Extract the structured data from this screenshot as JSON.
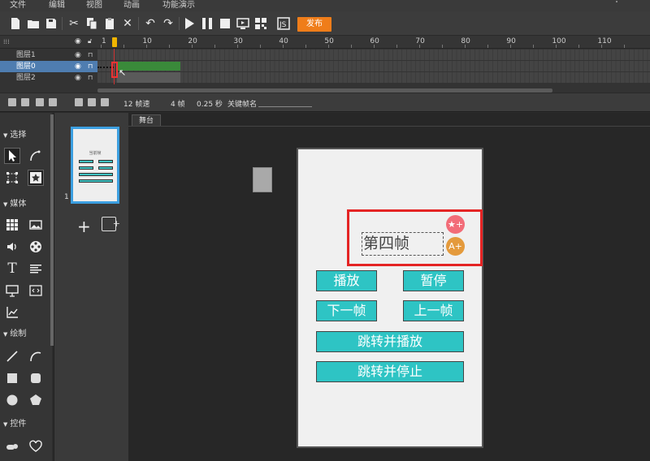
{
  "menu": [
    "文件",
    "编辑",
    "视图",
    "动画",
    "功能演示"
  ],
  "toolbar": {
    "publish_label": "发布",
    "icons": [
      "new-file-icon",
      "open-folder-icon",
      "save-icon",
      "cut-icon",
      "copy-icon",
      "paste-icon",
      "delete-icon",
      "undo-icon",
      "redo-icon",
      "play-icon",
      "pause-icon",
      "stop-icon",
      "preview-icon",
      "qrcode-icon",
      "export-icon"
    ]
  },
  "timeline": {
    "ruler_labels": [
      "1",
      "10",
      "20",
      "30",
      "40",
      "50",
      "60",
      "70",
      "80",
      "90",
      "100",
      "110"
    ],
    "layers": [
      {
        "name": "图层1",
        "selected": false
      },
      {
        "name": "图层0",
        "selected": true
      },
      {
        "name": "图层2",
        "selected": false
      }
    ]
  },
  "status": {
    "fps": "12 帧速",
    "frame": "4 帧",
    "time": "0.25 秒",
    "keyframe_label": "关键帧名"
  },
  "tools": {
    "sections": [
      "选择",
      "媒体",
      "绘制",
      "控件"
    ]
  },
  "scenes": {
    "thumb_number": "1",
    "thumb_title": "当前帧"
  },
  "stage": {
    "tab_label": "舞台",
    "frame_text": "第四帧",
    "buttons": {
      "play": "播放",
      "pause": "暂停",
      "next": "下一帧",
      "prev": "上一帧",
      "goto_play": "跳转并播放",
      "goto_stop": "跳转并停止"
    }
  },
  "colors": {
    "accent": "#ef7d1a",
    "button": "#2ec4c4",
    "selection": "#4f7db0",
    "highlight": "#e42424"
  }
}
